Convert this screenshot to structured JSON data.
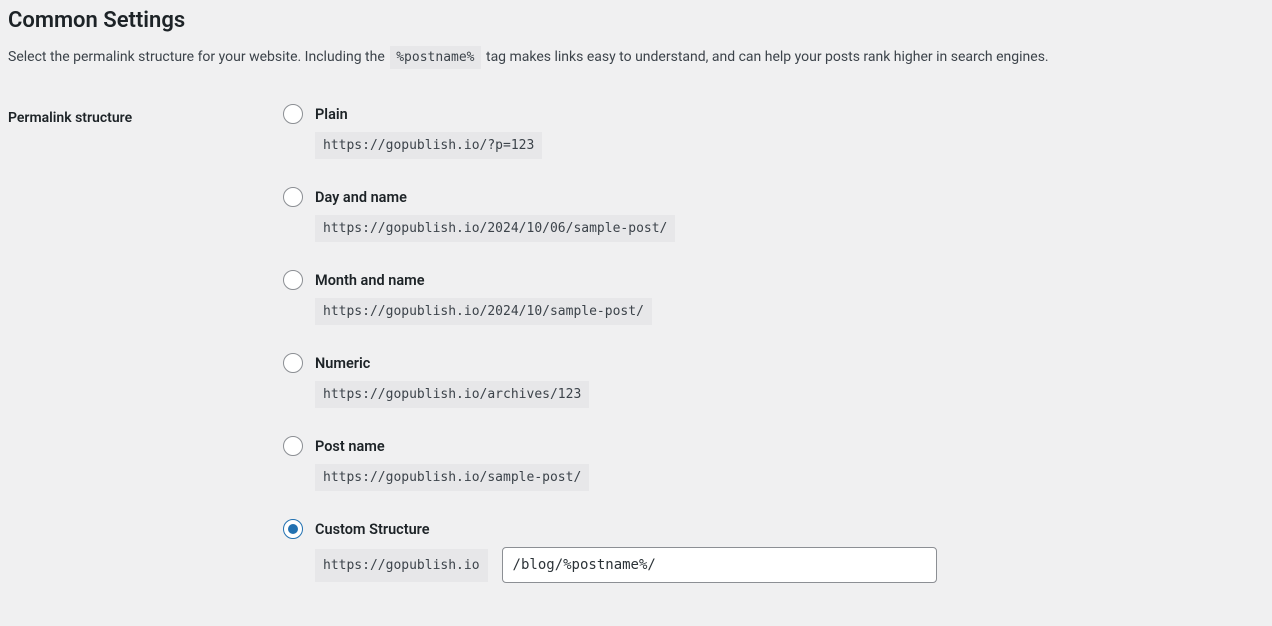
{
  "section": {
    "title": "Common Settings",
    "description_pre": "Select the permalink structure for your website. Including the ",
    "description_tag": "%postname%",
    "description_post": " tag makes links easy to understand, and can help your posts rank higher in search engines."
  },
  "form": {
    "label": "Permalink structure"
  },
  "options": [
    {
      "id": "plain",
      "label": "Plain",
      "example": "https://gopublish.io/?p=123",
      "checked": false
    },
    {
      "id": "day-name",
      "label": "Day and name",
      "example": "https://gopublish.io/2024/10/06/sample-post/",
      "checked": false
    },
    {
      "id": "month-name",
      "label": "Month and name",
      "example": "https://gopublish.io/2024/10/sample-post/",
      "checked": false
    },
    {
      "id": "numeric",
      "label": "Numeric",
      "example": "https://gopublish.io/archives/123",
      "checked": false
    },
    {
      "id": "post-name",
      "label": "Post name",
      "example": "https://gopublish.io/sample-post/",
      "checked": false
    },
    {
      "id": "custom",
      "label": "Custom Structure",
      "prefix": "https://gopublish.io",
      "value": "/blog/%postname%/",
      "checked": true
    }
  ]
}
